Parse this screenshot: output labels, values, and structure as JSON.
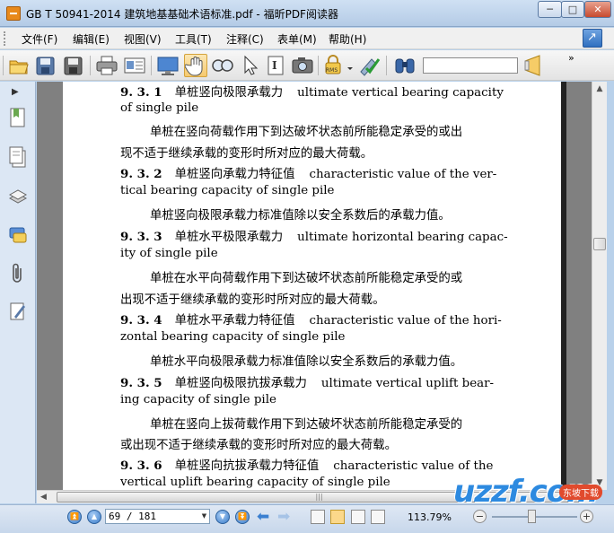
{
  "window": {
    "title": "GB T 50941-2014 建筑地基基础术语标准.pdf - 福昕PDF阅读器",
    "min_label": "─",
    "max_label": "□",
    "close_label": "✕"
  },
  "menu": {
    "items": [
      {
        "label": "文件(F)"
      },
      {
        "label": "编辑(E)"
      },
      {
        "label": "视图(V)"
      },
      {
        "label": "工具(T)"
      },
      {
        "label": "注释(C)"
      },
      {
        "label": "表单(M)"
      },
      {
        "label": "帮助(H)"
      }
    ]
  },
  "toolbar": {
    "icons": [
      "open-folder-icon",
      "save-icon",
      "save-as-icon",
      "print-icon",
      "properties-icon",
      "fullscreen-icon",
      "hand-tool-icon",
      "zoom-tool-icon",
      "select-arrow-icon",
      "text-select-icon",
      "snapshot-icon",
      "rms-lock-icon",
      "sign-check-icon",
      "find-binoculars-icon",
      "search-next-icon"
    ],
    "rms_label": "RMS",
    "search_value": "",
    "overflow_label": "»"
  },
  "document": {
    "lines": [
      {
        "num": "9. 3. 1",
        "cn": "单桩竖向极限承载力",
        "en": "ultimate vertical bearing capacity"
      },
      {
        "text": "of single pile"
      },
      {
        "text": "单桩在竖向荷载作用下到达破坏状态前所能稳定承受的或出",
        "indent": true
      },
      {
        "text": "现不适于继续承载的变形时所对应的最大荷载。"
      },
      {
        "num": "9. 3. 2",
        "cn": "单桩竖向承载力特征值",
        "en": "characteristic value of the ver-"
      },
      {
        "text": "tical bearing capacity of single pile"
      },
      {
        "text": "单桩竖向极限承载力标准值除以安全系数后的承载力值。",
        "indent": true
      },
      {
        "num": "9. 3. 3",
        "cn": "单桩水平极限承载力",
        "en": "ultimate horizontal bearing capac-"
      },
      {
        "text": "ity of single pile"
      },
      {
        "text": "单桩在水平向荷载作用下到达破坏状态前所能稳定承受的或",
        "indent": true
      },
      {
        "text": "出现不适于继续承载的变形时所对应的最大荷载。"
      },
      {
        "num": "9. 3. 4",
        "cn": "单桩水平承载力特征值",
        "en": "characteristic value of the hori-"
      },
      {
        "text": "zontal bearing capacity of single pile"
      },
      {
        "text": "单桩水平向极限承载力标准值除以安全系数后的承载力值。",
        "indent": true
      },
      {
        "num": "9. 3. 5",
        "cn": "单桩竖向极限抗拔承载力",
        "en": "ultimate vertical uplift bear-"
      },
      {
        "text": "ing capacity of single pile"
      },
      {
        "text": "单桩在竖向上拔荷载作用下到达破坏状态前所能稳定承受的",
        "indent": true
      },
      {
        "text": "或出现不适于继续承载的变形时所对应的最大荷载。"
      },
      {
        "num": "9. 3. 6",
        "cn": "单桩竖向抗拔承载力特征值",
        "en": "characteristic value of the"
      },
      {
        "text": "vertical uplift bearing capacity of single pile"
      }
    ]
  },
  "status": {
    "page_field": "69 / 181",
    "zoom": "113.79%",
    "zoom_minus": "−",
    "zoom_plus": "+"
  },
  "watermark": {
    "logo": "uzzf.com",
    "sub": "东坡下载"
  }
}
